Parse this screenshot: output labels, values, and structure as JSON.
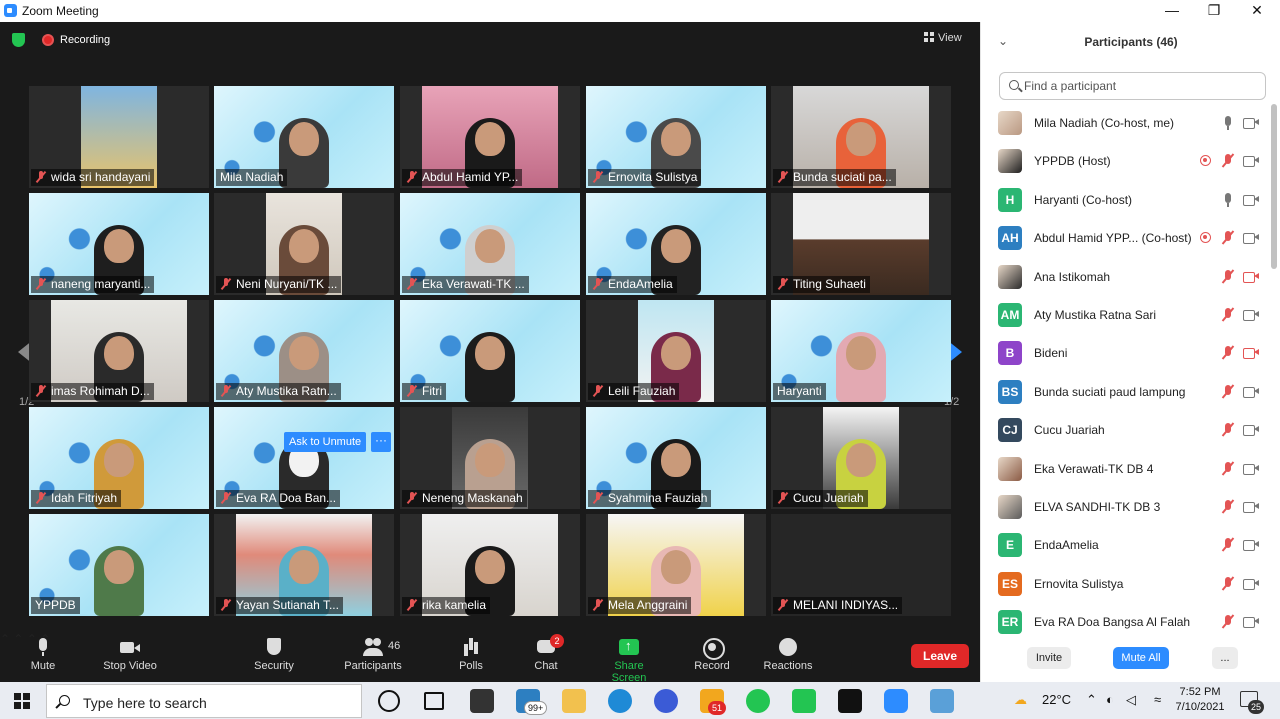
{
  "window": {
    "title": "Zoom Meeting",
    "minimize": "—",
    "restore": "❐",
    "close": "✕"
  },
  "topbar": {
    "recording_label": "Recording",
    "view_label": "View"
  },
  "gallery": {
    "page_indicator": "1/2",
    "ask_to_unmute": "Ask to Unmute",
    "more": "···",
    "tiles": [
      {
        "name": "wida sri handayani"
      },
      {
        "name": "Mila Nadiah"
      },
      {
        "name": "Abdul Hamid YP..."
      },
      {
        "name": "Ernovita Sulistya"
      },
      {
        "name": "Bunda suciati pa..."
      },
      {
        "name": "naneng maryanti..."
      },
      {
        "name": "Neni Nuryani/TK ..."
      },
      {
        "name": "Eka Verawati-TK ..."
      },
      {
        "name": "EndaAmelia"
      },
      {
        "name": "Titing Suhaeti"
      },
      {
        "name": "imas Rohimah D..."
      },
      {
        "name": "Aty Mustika Ratn..."
      },
      {
        "name": "Fitri"
      },
      {
        "name": "Leili Fauziah"
      },
      {
        "name": "Haryanti"
      },
      {
        "name": "Idah Fitriyah"
      },
      {
        "name": "Eva RA Doa Ban..."
      },
      {
        "name": "Neneng Maskanah"
      },
      {
        "name": "Syahmina Fauziah"
      },
      {
        "name": "Cucu Juariah"
      },
      {
        "name": "YPPDB"
      },
      {
        "name": "Yayan Sutianah T..."
      },
      {
        "name": "rika kamelia"
      },
      {
        "name": "Mela Anggraini"
      },
      {
        "name": "MELANI INDIYAS..."
      }
    ]
  },
  "toolbar": {
    "mute": "Mute",
    "stop_video": "Stop Video",
    "security": "Security",
    "participants": "Participants",
    "participants_count": "46",
    "polls": "Polls",
    "chat": "Chat",
    "chat_badge": "2",
    "share_screen": "Share Screen",
    "record": "Record",
    "reactions": "Reactions",
    "leave": "Leave",
    "caret": "⌃"
  },
  "panel": {
    "title": "Participants (46)",
    "collapse": "⌄",
    "search_placeholder": "Find a participant",
    "participants": [
      {
        "initials": "",
        "name": "Mila Nadiah (Co-host, me)",
        "color": "",
        "mic": "on",
        "cam": "on",
        "rec": false
      },
      {
        "initials": "",
        "name": "YPPDB (Host)",
        "color": "",
        "mic": "off",
        "cam": "on",
        "rec": true
      },
      {
        "initials": "H",
        "name": "Haryanti (Co-host)",
        "color": "#2bb673",
        "mic": "on",
        "cam": "on",
        "rec": false
      },
      {
        "initials": "AH",
        "name": "Abdul Hamid YPP... (Co-host)",
        "color": "#2d7fc1",
        "mic": "off",
        "cam": "on",
        "rec": true
      },
      {
        "initials": "",
        "name": "Ana Istikomah",
        "color": "",
        "mic": "off",
        "cam": "off",
        "rec": false
      },
      {
        "initials": "AM",
        "name": "Aty Mustika Ratna Sari",
        "color": "#2bb673",
        "mic": "off",
        "cam": "on",
        "rec": false
      },
      {
        "initials": "B",
        "name": "Bideni",
        "color": "#8e44c9",
        "mic": "off",
        "cam": "off",
        "rec": false
      },
      {
        "initials": "BS",
        "name": "Bunda suciati paud lampung",
        "color": "#2d7fc1",
        "mic": "off",
        "cam": "on",
        "rec": false
      },
      {
        "initials": "CJ",
        "name": "Cucu Juariah",
        "color": "#34495e",
        "mic": "off",
        "cam": "on",
        "rec": false
      },
      {
        "initials": "",
        "name": "Eka Verawati-TK DB 4",
        "color": "",
        "mic": "off",
        "cam": "on",
        "rec": false
      },
      {
        "initials": "",
        "name": "ELVA SANDHI-TK DB 3",
        "color": "",
        "mic": "off",
        "cam": "on",
        "rec": false
      },
      {
        "initials": "E",
        "name": "EndaAmelia",
        "color": "#2bb673",
        "mic": "off",
        "cam": "on",
        "rec": false
      },
      {
        "initials": "ES",
        "name": "Ernovita Sulistya",
        "color": "#e46a1f",
        "mic": "off",
        "cam": "on",
        "rec": false
      },
      {
        "initials": "ER",
        "name": "Eva RA Doa Bangsa Al Falah",
        "color": "#2bb673",
        "mic": "off",
        "cam": "on",
        "rec": false
      }
    ],
    "invite": "Invite",
    "mute_all": "Mute All",
    "more": "..."
  },
  "taskbar": {
    "search_text": "Type here to search",
    "mail_badge": "99+",
    "app_badge": "51",
    "temperature": "22°C",
    "time": "7:52 PM",
    "date": "7/10/2021",
    "notifications": "25"
  }
}
